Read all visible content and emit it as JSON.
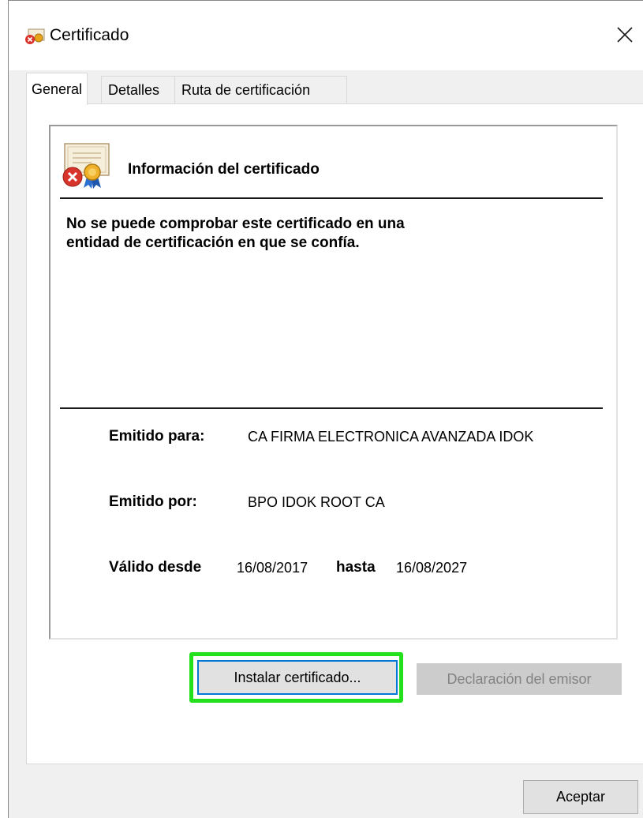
{
  "window": {
    "title": "Certificado",
    "title_icon": "certificate-error-icon",
    "close_icon": "close-icon"
  },
  "tabs": [
    {
      "label": "General",
      "active": true
    },
    {
      "label": "Detalles",
      "active": false
    },
    {
      "label": "Ruta de certificación",
      "active": false
    }
  ],
  "general": {
    "heading": "Información del certificado",
    "heading_icon": "certificate-invalid-icon",
    "warning_line1": "No se puede comprobar este certificado en una",
    "warning_line2": "entidad de certificación en que se confía.",
    "issued_to_label": "Emitido para:",
    "issued_to_value": "CA FIRMA ELECTRONICA AVANZADA IDOK",
    "issued_by_label": "Emitido por:",
    "issued_by_value": "BPO IDOK ROOT CA",
    "valid_from_label": "Válido desde",
    "valid_from_value": "16/08/2017",
    "valid_to_label": "hasta",
    "valid_to_value": "16/08/2027"
  },
  "buttons": {
    "install": "Instalar certificado...",
    "issuer_statement": "Declaración del emisor",
    "ok": "Aceptar"
  },
  "colors": {
    "highlight": "#22e01c",
    "focus_border": "#0078d7",
    "disabled_text": "#838383"
  }
}
